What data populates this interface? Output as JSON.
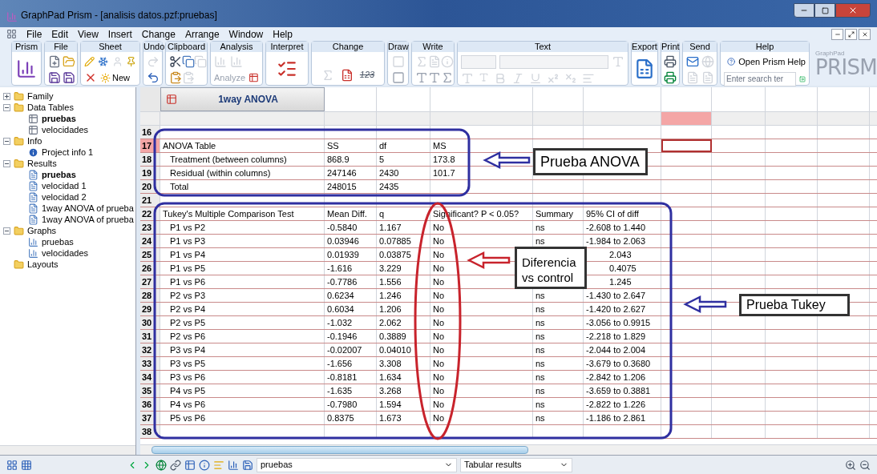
{
  "window": {
    "title": "GraphPad Prism - [analisis datos.pzf:pruebas]"
  },
  "menu": [
    "File",
    "Edit",
    "View",
    "Insert",
    "Change",
    "Arrange",
    "Window",
    "Help"
  ],
  "ribbon": [
    {
      "kind": "prism",
      "label": "Prism"
    },
    {
      "kind": "file",
      "label": "File"
    },
    {
      "kind": "sheet",
      "label": "Sheet",
      "text": "New"
    },
    {
      "kind": "undo",
      "label": "Undo"
    },
    {
      "kind": "clipboard",
      "label": "Clipboard"
    },
    {
      "kind": "analysis",
      "label": "Analysis",
      "text": "Analyze"
    },
    {
      "kind": "interpret",
      "label": "Interpret"
    },
    {
      "kind": "change",
      "label": "Change",
      "text": "123"
    },
    {
      "kind": "draw",
      "label": "Draw"
    },
    {
      "kind": "write",
      "label": "Write"
    },
    {
      "kind": "text",
      "label": "Text"
    },
    {
      "kind": "export",
      "label": "Export"
    },
    {
      "kind": "print",
      "label": "Print"
    },
    {
      "kind": "send",
      "label": "Send"
    },
    {
      "kind": "help",
      "label": "Help",
      "text": "Open Prism Help",
      "placeholder": "Enter search ter"
    }
  ],
  "logo": {
    "small": "GraphPad",
    "big": "PRISM"
  },
  "navigator": [
    {
      "kind": "folder",
      "label": "Family",
      "expanded": false
    },
    {
      "kind": "folder",
      "label": "Data Tables",
      "expanded": true,
      "children": [
        {
          "kind": "table",
          "label": "pruebas",
          "selected": true
        },
        {
          "kind": "table",
          "label": "velocidades",
          "selected": false
        }
      ]
    },
    {
      "kind": "folder",
      "label": "Info",
      "expanded": true,
      "children": [
        {
          "kind": "info",
          "label": "Project info 1",
          "selected": false
        }
      ]
    },
    {
      "kind": "folder",
      "label": "Results",
      "expanded": true,
      "children": [
        {
          "kind": "result",
          "label": "pruebas",
          "selected": true
        },
        {
          "kind": "result",
          "label": "velocidad 1",
          "selected": false
        },
        {
          "kind": "result",
          "label": "velocidad 2",
          "selected": false
        },
        {
          "kind": "result",
          "label": "1way ANOVA of prueba",
          "selected": false
        },
        {
          "kind": "result",
          "label": "1way ANOVA of prueba",
          "selected": false
        }
      ]
    },
    {
      "kind": "folder",
      "label": "Graphs",
      "expanded": true,
      "children": [
        {
          "kind": "graph",
          "label": "pruebas",
          "selected": false
        },
        {
          "kind": "graph",
          "label": "velocidades",
          "selected": false
        }
      ]
    },
    {
      "kind": "folder",
      "label": "Layouts"
    }
  ],
  "sheet": {
    "title": "1way ANOVA",
    "columns": [
      {
        "selected": false
      },
      {
        "selected": false
      },
      {
        "selected": false
      },
      {
        "selected": false
      },
      {
        "selected": false
      },
      {
        "selected": false
      },
      {
        "selected": true
      },
      {
        "selected": false
      },
      {
        "selected": false
      },
      {
        "selected": false
      }
    ],
    "rows": [
      {
        "number": "16",
        "kind": "blank",
        "selected": false
      },
      {
        "number": "17",
        "kind": "title",
        "selected": true,
        "cells": [
          "ANOVA Table",
          "SS",
          "df",
          "MS"
        ]
      },
      {
        "number": "18",
        "kind": "item",
        "selected": false,
        "cells": [
          "Treatment (between columns)",
          "868.9",
          "5",
          "173.8"
        ]
      },
      {
        "number": "19",
        "kind": "item",
        "selected": false,
        "cells": [
          "Residual (within columns)",
          "247146",
          "2430",
          "101.7"
        ]
      },
      {
        "number": "20",
        "kind": "item",
        "selected": false,
        "cells": [
          "Total",
          "248015",
          "2435"
        ]
      },
      {
        "number": "21",
        "kind": "blank",
        "selected": false
      },
      {
        "number": "22",
        "kind": "title",
        "selected": false,
        "cells": [
          "Tukey's Multiple Comparison Test",
          "Mean Diff.",
          "q",
          "Significant? P < 0.05?",
          "Summary",
          "95% CI of diff"
        ]
      },
      {
        "number": "23",
        "kind": "item",
        "selected": false,
        "cells": [
          "P1 vs P2",
          "-0.5840",
          "1.167",
          "No",
          "ns",
          "-2.608 to 1.440"
        ]
      },
      {
        "number": "24",
        "kind": "item",
        "selected": false,
        "cells": [
          "P1 vs P3",
          "0.03946",
          "0.07885",
          "No",
          "ns",
          "-1.984 to 2.063"
        ]
      },
      {
        "number": "25",
        "kind": "item",
        "selected": false,
        "covered": true,
        "cells": [
          "P1 vs P4",
          "0.01939",
          "0.03875",
          "No",
          null,
          "2.043"
        ]
      },
      {
        "number": "26",
        "kind": "item",
        "selected": false,
        "covered": true,
        "cells": [
          "P1 vs P5",
          "-1.616",
          "3.229",
          "No",
          null,
          "0.4075"
        ]
      },
      {
        "number": "27",
        "kind": "item",
        "selected": false,
        "covered": true,
        "cells": [
          "P1 vs P6",
          "-0.7786",
          "1.556",
          "No",
          null,
          "1.245"
        ]
      },
      {
        "number": "28",
        "kind": "item",
        "selected": false,
        "cells": [
          "P2 vs P3",
          "0.6234",
          "1.246",
          "No",
          "ns",
          "-1.430 to 2.647"
        ]
      },
      {
        "number": "29",
        "kind": "item",
        "selected": false,
        "cells": [
          "P2 vs P4",
          "0.6034",
          "1.206",
          "No",
          "ns",
          "-1.420 to 2.627"
        ]
      },
      {
        "number": "30",
        "kind": "item",
        "selected": false,
        "cells": [
          "P2 vs P5",
          "-1.032",
          "2.062",
          "No",
          "ns",
          "-3.056 to 0.9915"
        ]
      },
      {
        "number": "31",
        "kind": "item",
        "selected": false,
        "cells": [
          "P2 vs P6",
          "-0.1946",
          "0.3889",
          "No",
          "ns",
          "-2.218 to 1.829"
        ]
      },
      {
        "number": "32",
        "kind": "item",
        "selected": false,
        "cells": [
          "P3 vs P4",
          "-0.02007",
          "0.04010",
          "No",
          "ns",
          "-2.044 to 2.004"
        ]
      },
      {
        "number": "33",
        "kind": "item",
        "selected": false,
        "cells": [
          "P3 vs P5",
          "-1.656",
          "3.308",
          "No",
          "ns",
          "-3.679 to 0.3680"
        ]
      },
      {
        "number": "34",
        "kind": "item",
        "selected": false,
        "cells": [
          "P3 vs P6",
          "-0.8181",
          "1.634",
          "No",
          "ns",
          "-2.842 to 1.206"
        ]
      },
      {
        "number": "35",
        "kind": "item",
        "selected": false,
        "cells": [
          "P4 vs P5",
          "-1.635",
          "3.268",
          "No",
          "ns",
          "-3.659 to 0.3881"
        ]
      },
      {
        "number": "36",
        "kind": "item",
        "selected": false,
        "cells": [
          "P4 vs P6",
          "-0.7980",
          "1.594",
          "No",
          "ns",
          "-2.822 to 1.226"
        ]
      },
      {
        "number": "37",
        "kind": "item",
        "selected": false,
        "cells": [
          "P5 vs P6",
          "0.8375",
          "1.673",
          "No",
          "ns",
          "-1.186 to 2.861"
        ]
      },
      {
        "number": "38",
        "kind": "blank",
        "selected": false
      }
    ]
  },
  "annotations": [
    {
      "kind": "anova",
      "text": "Prueba ANOVA"
    },
    {
      "kind": "difference",
      "text": "Diferencia vs control"
    },
    {
      "kind": "tukey",
      "text": "Prueba Tukey"
    }
  ],
  "status_bar": {
    "sheet": "pruebas",
    "view": "Tabular results"
  }
}
